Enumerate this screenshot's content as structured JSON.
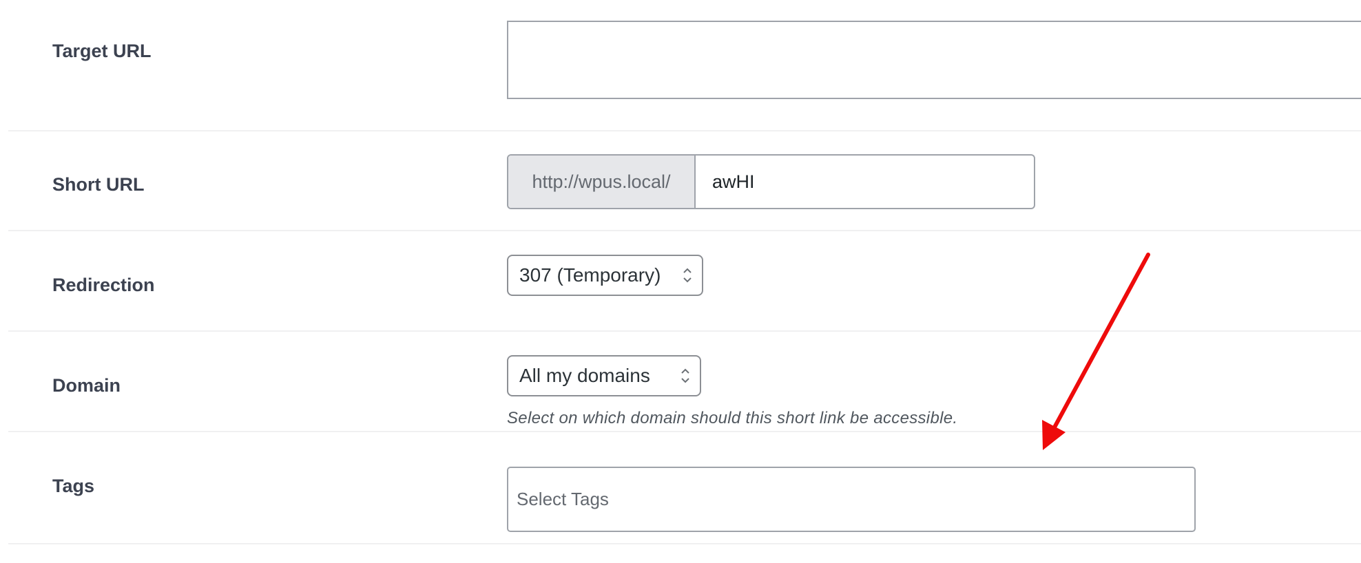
{
  "form": {
    "target_url": {
      "label": "Target URL",
      "value": ""
    },
    "short_url": {
      "label": "Short URL",
      "prefix": "http://wpus.local/",
      "value": "awHI"
    },
    "redirection": {
      "label": "Redirection",
      "selected": "307 (Temporary)"
    },
    "domain": {
      "label": "Domain",
      "selected": "All my domains",
      "help": "Select on which domain should this short link be accessible."
    },
    "tags": {
      "label": "Tags",
      "placeholder": "Select Tags"
    }
  },
  "icons": {
    "select_chevron": "chevron-up-down-icon",
    "annotation": "red-arrow-icon"
  },
  "colors": {
    "annotation_arrow": "#ee0b0b",
    "prefix_background": "#e6e7ea",
    "border": "#9fa3aa"
  }
}
